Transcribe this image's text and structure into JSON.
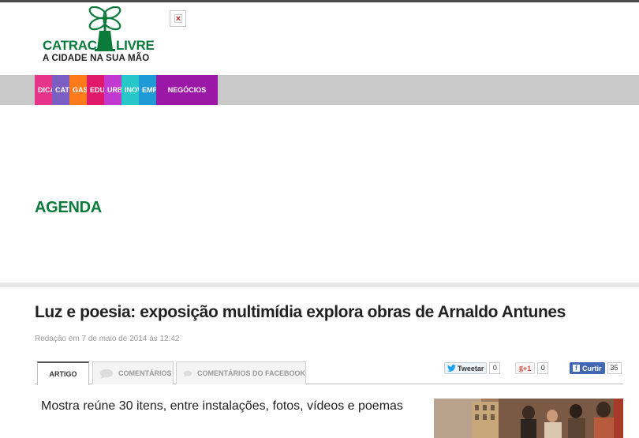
{
  "logo": {
    "name_part1": "CATRACA",
    "name_part2": "LIVRE",
    "tagline": "A CIDADE NA SUA MÃO",
    "brand_color": "#0b7a3b"
  },
  "nav": {
    "items": [
      {
        "label": "DICAS",
        "color": "#e6348a",
        "width": 22
      },
      {
        "label": "CATRACA",
        "color": "#7a5ec4",
        "width": 22
      },
      {
        "label": "GASTRONOMIA",
        "color": "#ff7a1a",
        "width": 22
      },
      {
        "label": "EDUCAÇÃO",
        "color": "#e0196a",
        "width": 22
      },
      {
        "label": "URBANISMO",
        "color": "#c03ad0",
        "width": 22
      },
      {
        "label": "INOVAÇÃO",
        "color": "#27c7c7",
        "width": 22
      },
      {
        "label": "EMPREENDEDORISMO",
        "color": "#1f9ad6",
        "width": 22
      },
      {
        "label": "NEGÓCIOS",
        "color": "#9b17a6",
        "width": 78
      }
    ]
  },
  "section": {
    "title": "AGENDA"
  },
  "article": {
    "title": "Luz e poesia: exposição multimídia explora obras de Arnaldo Antunes",
    "byline": "Redação em 7 de maio de 2014 às 12:42",
    "subtitle": "Mostra reúne 30 itens, entre instalações, fotos, vídeos e poemas"
  },
  "tabs": [
    {
      "label": "ARTIGO",
      "active": true
    },
    {
      "label": "COMENTÁRIOS",
      "active": false,
      "icon": "speech-bubble-icon"
    },
    {
      "label": "COMENTÁRIOS DO FACEBOOK",
      "active": false,
      "icon": "speech-bubble-icon"
    }
  ],
  "social": {
    "twitter_label": "Tweetar",
    "twitter_count": "0",
    "gplus_label": "+1",
    "gplus_count": "0",
    "facebook_label": "Curtir",
    "facebook_count": "35",
    "twitter_icon": "twitter-bird-icon",
    "gplus_icon": "google-plus-icon",
    "facebook_icon": "facebook-f-icon"
  }
}
